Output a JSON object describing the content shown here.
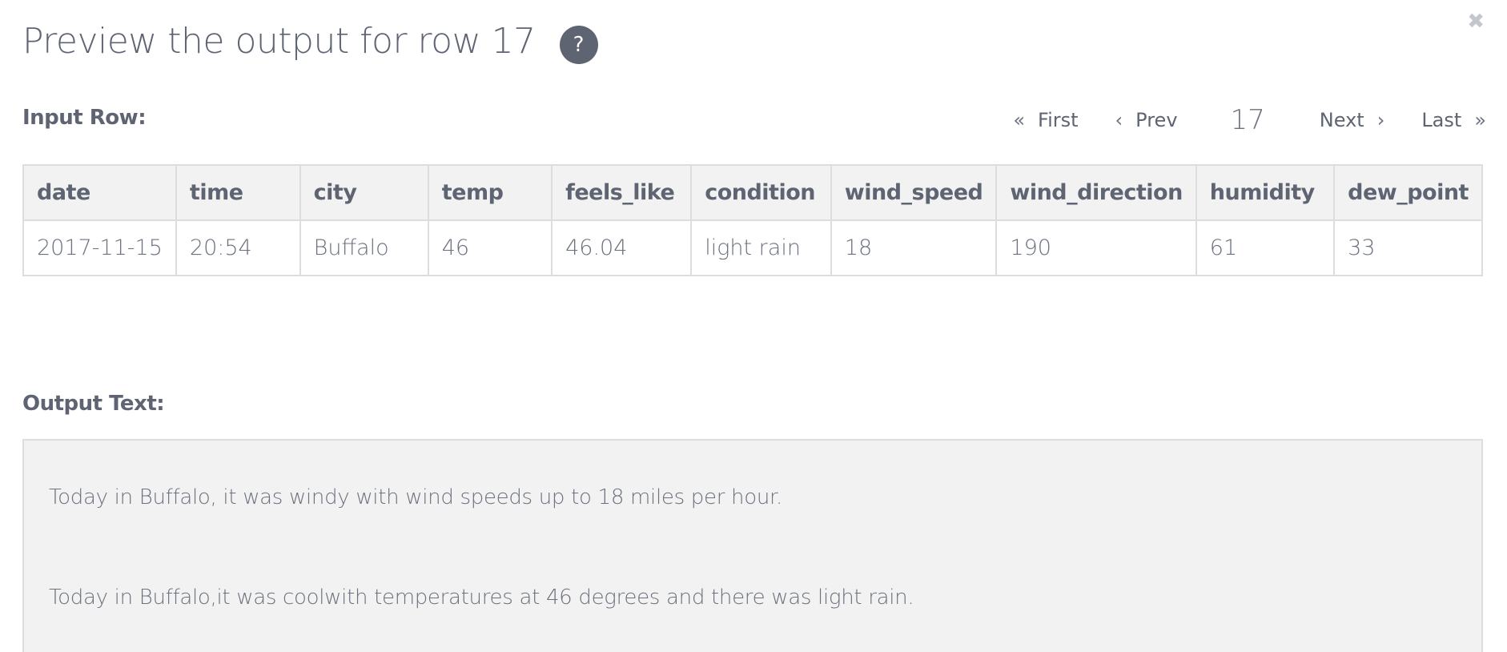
{
  "dialog": {
    "title": "Preview the output for row 17",
    "help_icon": "?",
    "close_icon": "✖"
  },
  "input_row": {
    "label": "Input Row:",
    "columns": [
      "date",
      "time",
      "city",
      "temp",
      "feels_like",
      "condition",
      "wind_speed",
      "wind_direction",
      "humidity",
      "dew_point"
    ],
    "values": [
      "2017-11-15",
      "20:54",
      "Buffalo",
      "46",
      "46.04",
      "light rain",
      "18",
      "190",
      "61",
      "33"
    ]
  },
  "pager": {
    "first_icon": "«",
    "first_label": "First",
    "prev_icon": "‹",
    "prev_label": "Prev",
    "current": "17",
    "next_label": "Next",
    "next_icon": "›",
    "last_label": "Last",
    "last_icon": "»"
  },
  "output": {
    "label": "Output Text:",
    "lines": [
      "Today in Buffalo, it was windy with wind speeds up to 18 miles per hour.",
      "Today in Buffalo,it was coolwith temperatures at 46 degrees and there was light rain."
    ]
  },
  "colors": {
    "text": "#6b717e",
    "heading": "#5e6472",
    "header_bg": "#f2f2f2",
    "border": "#dcdde0",
    "help_bg": "#5e6472"
  }
}
